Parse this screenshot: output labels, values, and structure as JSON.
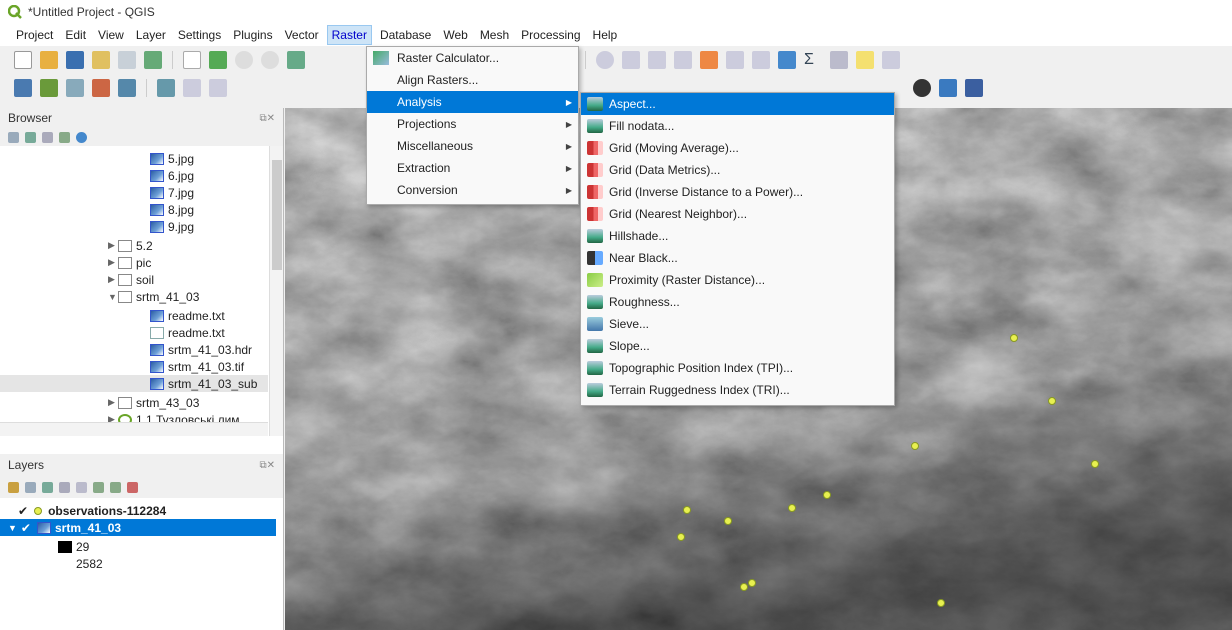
{
  "window": {
    "title": "*Untitled Project - QGIS"
  },
  "menubar": [
    "Project",
    "Edit",
    "View",
    "Layer",
    "Settings",
    "Plugins",
    "Vector",
    "Raster",
    "Database",
    "Web",
    "Mesh",
    "Processing",
    "Help"
  ],
  "raster_menu": [
    {
      "label": "Raster Calculator...",
      "submenu": false
    },
    {
      "label": "Align Rasters...",
      "submenu": false
    },
    {
      "label": "Analysis",
      "submenu": true
    },
    {
      "label": "Projections",
      "submenu": true
    },
    {
      "label": "Miscellaneous",
      "submenu": true
    },
    {
      "label": "Extraction",
      "submenu": true
    },
    {
      "label": "Conversion",
      "submenu": true
    }
  ],
  "analysis_submenu": [
    {
      "label": "Aspect...",
      "icon": "gdal-icon"
    },
    {
      "label": "Fill nodata...",
      "icon": "gdal-icon"
    },
    {
      "label": "Grid (Moving Average)...",
      "icon": "grid-icon"
    },
    {
      "label": "Grid (Data Metrics)...",
      "icon": "grid-icon"
    },
    {
      "label": "Grid (Inverse Distance to a Power)...",
      "icon": "grid-icon"
    },
    {
      "label": "Grid (Nearest Neighbor)...",
      "icon": "grid-icon"
    },
    {
      "label": "Hillshade...",
      "icon": "gdal-icon"
    },
    {
      "label": "Near Black...",
      "icon": "near-black-icon"
    },
    {
      "label": "Proximity (Raster Distance)...",
      "icon": "proximity-icon"
    },
    {
      "label": "Roughness...",
      "icon": "gdal-icon"
    },
    {
      "label": "Sieve...",
      "icon": "sieve-icon"
    },
    {
      "label": "Slope...",
      "icon": "gdal-icon"
    },
    {
      "label": "Topographic Position Index (TPI)...",
      "icon": "gdal-icon"
    },
    {
      "label": "Terrain Ruggedness Index (TRI)...",
      "icon": "gdal-icon"
    }
  ],
  "browser": {
    "title": "Browser",
    "items": [
      {
        "label": "5.jpg",
        "type": "image"
      },
      {
        "label": "6.jpg",
        "type": "image"
      },
      {
        "label": "7.jpg",
        "type": "image"
      },
      {
        "label": "8.jpg",
        "type": "image"
      },
      {
        "label": "9.jpg",
        "type": "image"
      },
      {
        "label": "5.2",
        "type": "folder"
      },
      {
        "label": "pic",
        "type": "folder"
      },
      {
        "label": "soil",
        "type": "folder"
      },
      {
        "label": "srtm_41_03",
        "type": "folder"
      },
      {
        "label": "readme.txt",
        "type": "image"
      },
      {
        "label": "readme.txt",
        "type": "text"
      },
      {
        "label": "srtm_41_03.hdr",
        "type": "image"
      },
      {
        "label": "srtm_41_03.tif",
        "type": "image"
      },
      {
        "label": "srtm_41_03_sub",
        "type": "image"
      },
      {
        "label": "srtm_43_03",
        "type": "folder"
      },
      {
        "label": "1.1 Тузловські лим",
        "type": "project"
      }
    ]
  },
  "layers": {
    "title": "Layers",
    "items": [
      {
        "label": "observations-112284",
        "checked": true
      },
      {
        "label": "srtm_41_03",
        "checked": true
      }
    ],
    "legend": [
      "29",
      "2582"
    ]
  },
  "colors": {
    "selection": "#0078d7",
    "points": "#e8f050"
  }
}
